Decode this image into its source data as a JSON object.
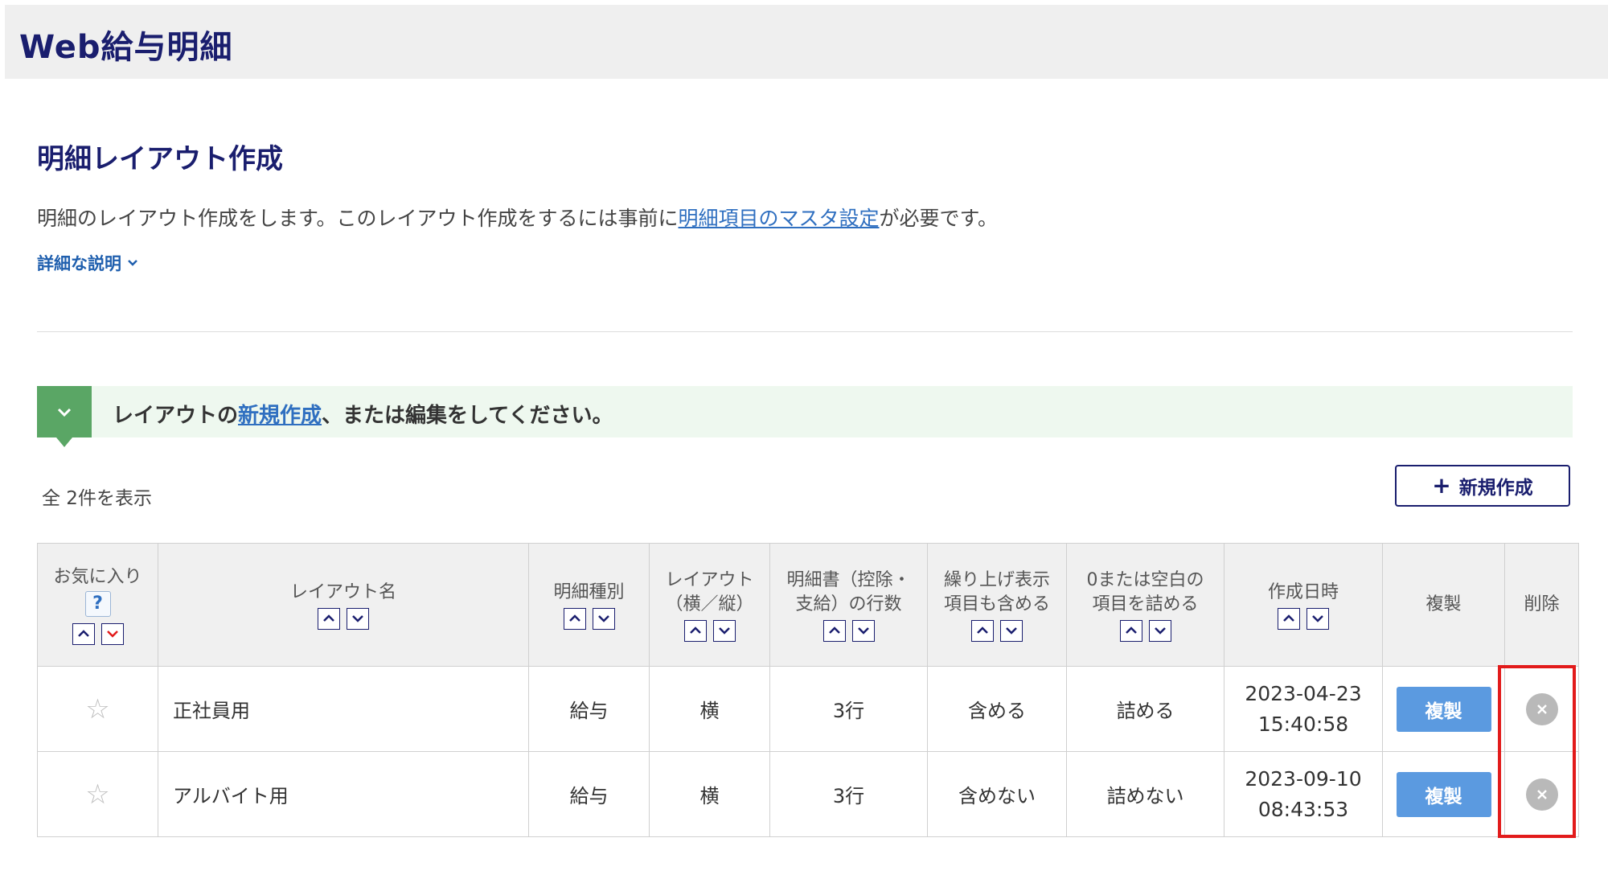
{
  "app": {
    "title": "Web給与明細"
  },
  "page": {
    "title": "明細レイアウト作成",
    "desc_before": "明細のレイアウト作成をします。このレイアウト作成をするには事前に",
    "desc_link": "明細項目のマスタ設定",
    "desc_after": "が必要です。",
    "detail_toggle": "詳細な説明"
  },
  "notice": {
    "text_before": "レイアウトの",
    "link": "新規作成",
    "text_after": "、または編集をしてください。"
  },
  "list": {
    "count_text": "全 2件を表示",
    "new_button": "新規作成"
  },
  "table": {
    "headers": {
      "favorite": "お気に入り",
      "help": "?",
      "name": "レイアウト名",
      "type": "明細種別",
      "layout_l1": "レイアウト",
      "layout_l2": "（横／縦）",
      "rows_l1": "明細書（控除・",
      "rows_l2": "支給）の行数",
      "roundup_l1": "繰り上げ表示",
      "roundup_l2": "項目も含める",
      "zero_l1": "0または空白の",
      "zero_l2": "項目を詰める",
      "created": "作成日時",
      "copy": "複製",
      "delete": "削除"
    },
    "rows": [
      {
        "name": "正社員用",
        "type": "給与",
        "layout": "横",
        "rows": "3行",
        "roundup": "含める",
        "zero": "詰める",
        "date": "2023-04-23",
        "time": "15:40:58",
        "copy_label": "複製"
      },
      {
        "name": "アルバイト用",
        "type": "給与",
        "layout": "横",
        "rows": "3行",
        "roundup": "含めない",
        "zero": "詰めない",
        "date": "2023-09-10",
        "time": "08:43:53",
        "copy_label": "複製"
      }
    ]
  },
  "colors": {
    "brand": "#1a1e6e",
    "link": "#2f6fc0",
    "notice_green": "#5aa665",
    "copy_button": "#5b9ae0",
    "highlight": "#e21b1b"
  }
}
